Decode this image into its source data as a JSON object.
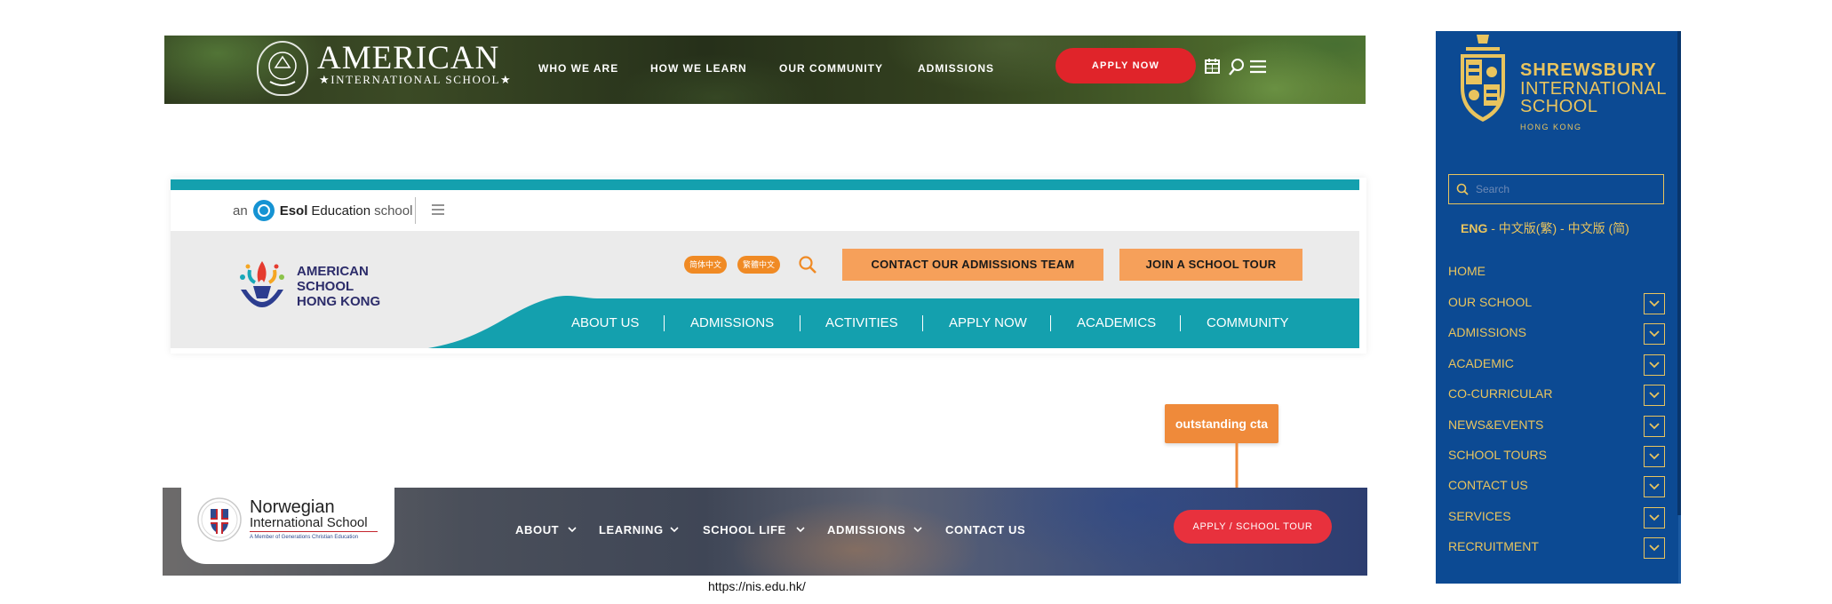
{
  "colors": {
    "ais_apply_red": "#e0242a",
    "ashk_teal": "#14a0ae",
    "ashk_orange": "#f6a05a",
    "nis_apply_red": "#e8313d",
    "annotation_orange": "#ef8a3a",
    "shrewsbury_blue": "#0c4a93",
    "shrewsbury_gold": "#e9c45e"
  },
  "ais": {
    "brand_main": "AMERICAN",
    "brand_sub": "★INTERNATIONAL SCHOOL★",
    "nav": [
      "WHO WE ARE",
      "HOW WE LEARN",
      "OUR COMMUNITY",
      "ADMISSIONS"
    ],
    "apply_label": "APPLY NOW",
    "icons": [
      "calendar-icon",
      "search-icon",
      "menu-icon"
    ]
  },
  "ashk": {
    "esol_prefix": "an",
    "esol_brand": "Esol",
    "esol_mid": "Education",
    "esol_suffix": "school",
    "logo_line1": "AMERICAN",
    "logo_line2": "SCHOOL",
    "logo_line3": "HONG KONG",
    "lang_simplified": "简体中文",
    "lang_traditional": "繁體中文",
    "cta_admissions": "CONTACT OUR ADMISSIONS TEAM",
    "cta_tour": "JOIN A SCHOOL TOUR",
    "nav": [
      "ABOUT US",
      "ADMISSIONS",
      "ACTIVITIES",
      "APPLY NOW",
      "ACADEMICS",
      "COMMUNITY"
    ]
  },
  "nis": {
    "logo_line1": "Norwegian",
    "logo_line2": "International School",
    "logo_tagline": "A Member of Generations Christian Education",
    "nav": [
      "ABOUT",
      "LEARNING",
      "SCHOOL LIFE",
      "ADMISSIONS",
      "CONTACT US"
    ],
    "apply_label": "APPLY / SCHOOL TOUR",
    "url": "https://nis.edu.hk/"
  },
  "annotation": {
    "label": "outstanding cta"
  },
  "shrewsbury": {
    "name1": "SHREWSBURY",
    "name2": "INTERNATIONAL",
    "name3": "SCHOOL",
    "name4": "HONG KONG",
    "search_placeholder": "Search",
    "lang_eng": "ENG",
    "lang_sep": " - ",
    "lang_trad": "中文版(繁)",
    "lang_simp": "中文版 (简)",
    "menu": [
      "HOME",
      "OUR SCHOOL",
      "ADMISSIONS",
      "ACADEMIC",
      "CO-CURRICULAR",
      "NEWS&EVENTS",
      "SCHOOL TOURS",
      "CONTACT US",
      "SERVICES",
      "RECRUITMENT"
    ]
  }
}
